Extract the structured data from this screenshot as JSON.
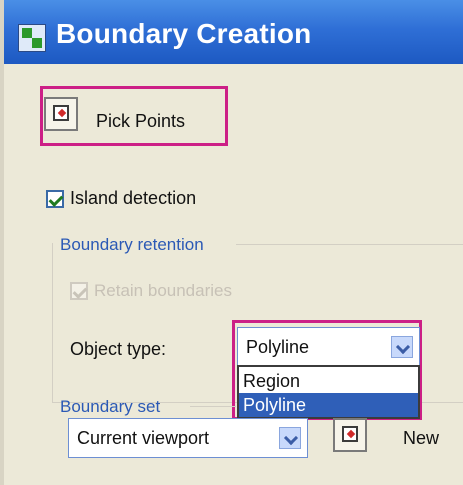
{
  "window": {
    "title": "Boundary Creation"
  },
  "pick_points": {
    "label": "Pick Points"
  },
  "island_detection": {
    "label": "Island detection",
    "checked": true
  },
  "boundary_retention": {
    "label": "Boundary retention",
    "retain_boundaries": {
      "label": "Retain boundaries",
      "checked": true,
      "enabled": false
    },
    "object_type": {
      "label": "Object type:",
      "value": "Polyline",
      "options": [
        "Region",
        "Polyline"
      ],
      "selected": "Polyline"
    }
  },
  "boundary_set": {
    "label": "Boundary set",
    "value": "Current viewport",
    "new_label": "New"
  },
  "colors": {
    "title_bar": "#2f6fd6",
    "highlight": "#cc1f86",
    "selection": "#2f5fb8",
    "group_label": "#2b59b5"
  },
  "icons": [
    "app-icon",
    "pick-points-icon",
    "dropdown-arrow-icon",
    "select-objects-icon"
  ]
}
